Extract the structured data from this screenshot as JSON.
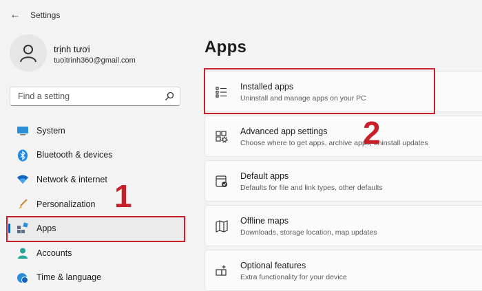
{
  "window": {
    "title": "Settings"
  },
  "user": {
    "name": "trịnh tươi",
    "email": "tuoitrinh360@gmail.com"
  },
  "search": {
    "placeholder": "Find a setting"
  },
  "sidebar": {
    "items": [
      {
        "label": "System",
        "icon": "monitor-icon",
        "active": false
      },
      {
        "label": "Bluetooth & devices",
        "icon": "bluetooth-icon",
        "active": false
      },
      {
        "label": "Network & internet",
        "icon": "wifi-icon",
        "active": false
      },
      {
        "label": "Personalization",
        "icon": "brush-icon",
        "active": false
      },
      {
        "label": "Apps",
        "icon": "apps-icon",
        "active": true
      },
      {
        "label": "Accounts",
        "icon": "person-icon",
        "active": false
      },
      {
        "label": "Time & language",
        "icon": "globe-clock-icon",
        "active": false
      }
    ]
  },
  "main": {
    "title": "Apps",
    "cards": [
      {
        "title": "Installed apps",
        "description": "Uninstall and manage apps on your PC",
        "icon": "list-icon"
      },
      {
        "title": "Advanced app settings",
        "description": "Choose where to get apps, archive apps, uninstall updates",
        "icon": "app-settings-icon"
      },
      {
        "title": "Default apps",
        "description": "Defaults for file and link types, other defaults",
        "icon": "default-apps-icon"
      },
      {
        "title": "Offline maps",
        "description": "Downloads, storage location, map updates",
        "icon": "map-icon"
      },
      {
        "title": "Optional features",
        "description": "Extra functionality for your device",
        "icon": "add-feature-icon"
      }
    ]
  },
  "annotations": {
    "step1": "1",
    "step2": "2",
    "color": "#c8202a"
  },
  "colors": {
    "accent": "#005fb8",
    "background": "#f3f3f3",
    "card": "#fbfbfb"
  }
}
